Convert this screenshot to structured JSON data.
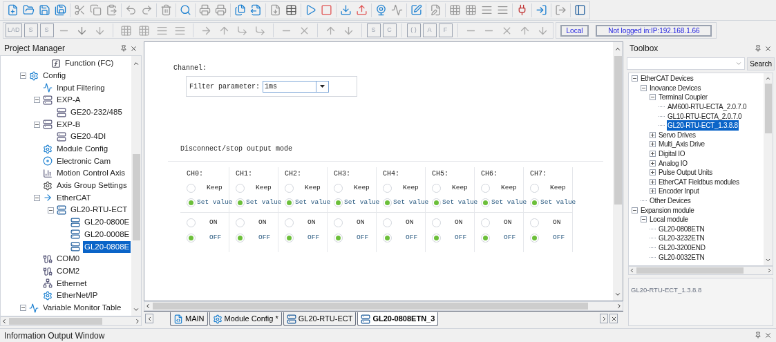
{
  "ladder_toolbar": {
    "labels": [
      "LAD",
      "S",
      "S",
      "S",
      "C",
      "( )",
      "A",
      "F"
    ]
  },
  "connection": {
    "mode": "Local",
    "status": "Not logged in:IP:192.168.1.66"
  },
  "project_manager": {
    "title": "Project Manager",
    "items": [
      {
        "label": "Function (FC)",
        "selected": false
      },
      {
        "label": "Config",
        "selected": false,
        "expanded": true,
        "children": [
          {
            "label": "Input Filtering",
            "selected": false
          },
          {
            "label": "EXP-A",
            "selected": false,
            "expanded": true,
            "children": [
              {
                "label": "GE20-232/485",
                "selected": false
              }
            ]
          },
          {
            "label": "EXP-B",
            "selected": false,
            "expanded": true,
            "children": [
              {
                "label": "GE20-4DI",
                "selected": false
              }
            ]
          },
          {
            "label": "Module Config",
            "selected": false
          },
          {
            "label": "Electronic Cam",
            "selected": false
          },
          {
            "label": "Motion Control Axis",
            "selected": false
          },
          {
            "label": "Axis Group Settings",
            "selected": false
          },
          {
            "label": "EtherCAT",
            "selected": false,
            "expanded": true,
            "children": [
              {
                "label": "GL20-RTU-ECT",
                "selected": false,
                "expanded": true,
                "children": [
                  {
                    "label": "GL20-0800E",
                    "selected": false
                  },
                  {
                    "label": "GL20-0008E",
                    "selected": false
                  },
                  {
                    "label": "GL20-0808E",
                    "selected": true
                  }
                ]
              }
            ]
          },
          {
            "label": "COM0",
            "selected": false
          },
          {
            "label": "COM2",
            "selected": false
          },
          {
            "label": "Ethernet",
            "selected": false
          },
          {
            "label": "EtherNet/IP",
            "selected": false
          }
        ]
      },
      {
        "label": "Variable Monitor Table",
        "selected": false,
        "expanded": true
      }
    ]
  },
  "editor": {
    "channel_label": "Channel:",
    "filter": {
      "label": "Filter parameter:",
      "value": "1ms"
    },
    "section_title": "Disconnect/stop output mode",
    "channels": [
      {
        "label": "CH0:",
        "modes": [
          {
            "label": "Keep",
            "selected": false
          },
          {
            "label": "Set value",
            "selected": true
          }
        ],
        "values": [
          {
            "label": "ON",
            "selected": false
          },
          {
            "label": "OFF",
            "selected": true
          }
        ]
      },
      {
        "label": "CH1:",
        "modes": [
          {
            "label": "Keep",
            "selected": false
          },
          {
            "label": "Set value",
            "selected": true
          }
        ],
        "values": [
          {
            "label": "ON",
            "selected": false
          },
          {
            "label": "OFF",
            "selected": true
          }
        ]
      },
      {
        "label": "CH2:",
        "modes": [
          {
            "label": "Keep",
            "selected": false
          },
          {
            "label": "Set value",
            "selected": true
          }
        ],
        "values": [
          {
            "label": "ON",
            "selected": false
          },
          {
            "label": "OFF",
            "selected": true
          }
        ]
      },
      {
        "label": "CH3:",
        "modes": [
          {
            "label": "Keep",
            "selected": false
          },
          {
            "label": "Set value",
            "selected": true
          }
        ],
        "values": [
          {
            "label": "ON",
            "selected": false
          },
          {
            "label": "OFF",
            "selected": true
          }
        ]
      },
      {
        "label": "CH4:",
        "modes": [
          {
            "label": "Keep",
            "selected": false
          },
          {
            "label": "Set value",
            "selected": true
          }
        ],
        "values": [
          {
            "label": "ON",
            "selected": false
          },
          {
            "label": "OFF",
            "selected": true
          }
        ]
      },
      {
        "label": "CH5:",
        "modes": [
          {
            "label": "Keep",
            "selected": false
          },
          {
            "label": "Set value",
            "selected": true
          }
        ],
        "values": [
          {
            "label": "ON",
            "selected": false
          },
          {
            "label": "OFF",
            "selected": true
          }
        ]
      },
      {
        "label": "CH6:",
        "modes": [
          {
            "label": "Keep",
            "selected": false
          },
          {
            "label": "Set value",
            "selected": true
          }
        ],
        "values": [
          {
            "label": "ON",
            "selected": false
          },
          {
            "label": "OFF",
            "selected": true
          }
        ]
      },
      {
        "label": "CH7:",
        "modes": [
          {
            "label": "Keep",
            "selected": false
          },
          {
            "label": "Set value",
            "selected": true
          }
        ],
        "values": [
          {
            "label": "ON",
            "selected": false
          },
          {
            "label": "OFF",
            "selected": true
          }
        ]
      }
    ]
  },
  "tabs": [
    {
      "label": "MAIN",
      "selected": false
    },
    {
      "label": "Module Config *",
      "selected": false
    },
    {
      "label": "GL20-RTU-ECT",
      "selected": false
    },
    {
      "label": "GL20-0808ETN_3",
      "selected": true
    }
  ],
  "toolbox": {
    "title": "Toolbox",
    "search_button": "Search",
    "items": [
      {
        "label": "EtherCAT Devices",
        "selected": false,
        "expanded": true,
        "children": [
          {
            "label": "Inovance Devices",
            "selected": false,
            "expanded": true,
            "children": [
              {
                "label": "Terminal Coupler",
                "selected": false,
                "expanded": true,
                "children": [
                  {
                    "label": "AM600-RTU-ECTA_2.0.7.0",
                    "selected": false
                  },
                  {
                    "label": "GL10-RTU-ECTA_2.0.7.0",
                    "selected": false
                  },
                  {
                    "label": "GL20-RTU-ECT_1.3.8.8",
                    "selected": true
                  }
                ]
              },
              {
                "label": "Servo Drives",
                "selected": false,
                "expanded": false
              },
              {
                "label": "Multi_Axis Drive",
                "selected": false,
                "expanded": false
              },
              {
                "label": "Digital IO",
                "selected": false,
                "expanded": false
              },
              {
                "label": "Analog IO",
                "selected": false,
                "expanded": false
              },
              {
                "label": "Pulse Output Units",
                "selected": false,
                "expanded": false
              },
              {
                "label": "EtherCAT Fieldbus modules",
                "selected": false,
                "expanded": false
              },
              {
                "label": "Encoder Input",
                "selected": false,
                "expanded": false
              }
            ]
          },
          {
            "label": "Other Devices",
            "selected": false
          }
        ]
      },
      {
        "label": "Expansion module",
        "selected": false,
        "expanded": true,
        "children": [
          {
            "label": "Local module",
            "selected": false,
            "expanded": true,
            "children": [
              {
                "label": "GL20-0808ETN",
                "selected": false
              },
              {
                "label": "GL20-3232ETN",
                "selected": false
              },
              {
                "label": "GL20-3200END",
                "selected": false
              },
              {
                "label": "GL20-0032ETN",
                "selected": false
              }
            ]
          }
        ]
      }
    ],
    "description": "GL20-RTU-ECT_1.3.8.8"
  },
  "output_window": {
    "title": "Information Output Window"
  }
}
